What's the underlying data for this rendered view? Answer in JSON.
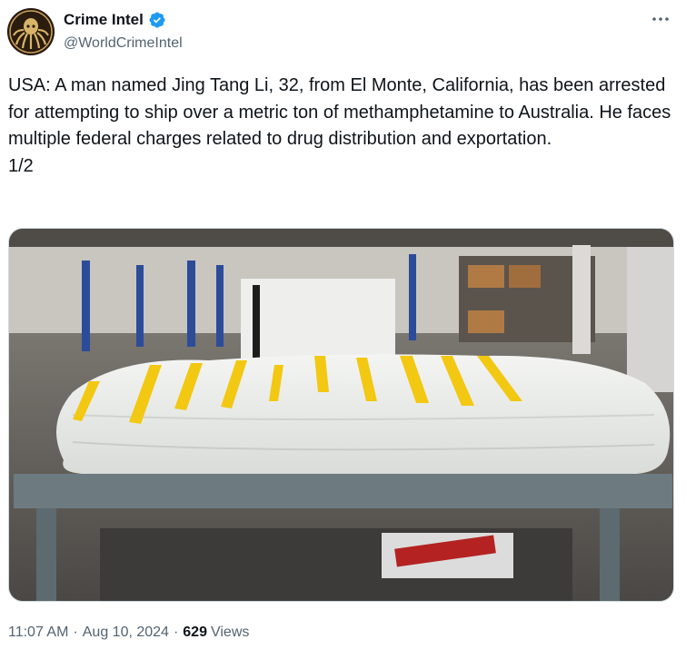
{
  "account": {
    "display_name": "Crime Intel",
    "handle": "@WorldCrimeIntel",
    "verified": true,
    "verified_color": "#1d9bf0"
  },
  "tweet": {
    "text": "USA: A man named Jing Tang Li, 32, from El Monte, California, has been arrested for attempting to ship over a metric ton of methamphetamine to Australia. He faces multiple federal charges related to drug distribution and exportation.\n1/2",
    "media_description_icon": "photo",
    "time": "11:07 AM",
    "date": "Aug 10, 2024",
    "views_count": "629",
    "views_label": "Views",
    "separator": "·"
  },
  "icons": {
    "more": "more-icon",
    "verified": "verified-badge-icon",
    "avatar": "octopus-logo"
  }
}
